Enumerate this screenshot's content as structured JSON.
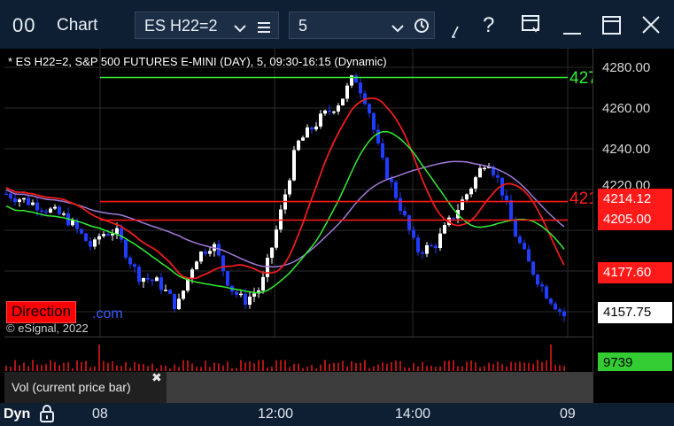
{
  "window": {
    "title": "Chart",
    "logo_glyph": "00",
    "symbol": "ES H22=2",
    "interval": "5",
    "icons": [
      "chevron-down-icon",
      "menu-icon",
      "clock-icon",
      "draw-icon",
      "help-icon",
      "layout-icon",
      "minimize-icon",
      "maximize-icon",
      "close-icon"
    ]
  },
  "chart": {
    "header": "* ES H22=2, S&P 500 FUTURES E-MINI (DAY), 5, 09:30-16:15 (Dynamic)",
    "watermark": "© eSignal, 2022",
    "direction_label": "Direction",
    "direction_tail": ".com",
    "green_line_label": "427",
    "red_line_label": "421"
  },
  "price_axis": {
    "labels": [
      "4280.00",
      "4260.00",
      "4240.00",
      "4220.00"
    ],
    "boxes": [
      {
        "value": "4214.12",
        "bg": "#ff1a1a",
        "fg": "#ffffff"
      },
      {
        "value": "4205.00",
        "bg": "#ff1a1a",
        "fg": "#ffffff"
      },
      {
        "value": "4177.60",
        "bg": "#ff1a1a",
        "fg": "#ffffff"
      },
      {
        "value": "4157.75",
        "bg": "#ffffff",
        "fg": "#000000"
      }
    ],
    "volume_value": "9739",
    "volume_bg": "#33cc33"
  },
  "volume_pane": {
    "label": "Vol (current price bar)",
    "close_glyph": "✖"
  },
  "time_axis": {
    "mode": "Dyn",
    "labels": [
      "08",
      "12:00",
      "14:00",
      "09"
    ]
  },
  "chart_data": {
    "type": "candlestick",
    "y_range": [
      4145,
      4290
    ],
    "colors": {
      "up": "#ffffff",
      "down": "#1f3dff",
      "ma_fast": "#33ee33",
      "ma_slow": "#ee1c1c",
      "ma_purple": "#a07ad8"
    },
    "horizontal_levels": [
      {
        "value": 4275,
        "color": "#33ee33"
      },
      {
        "value": 4214.12,
        "color": "#ff1a1a"
      },
      {
        "value": 4205.0,
        "color": "#ff1a1a"
      }
    ]
  }
}
